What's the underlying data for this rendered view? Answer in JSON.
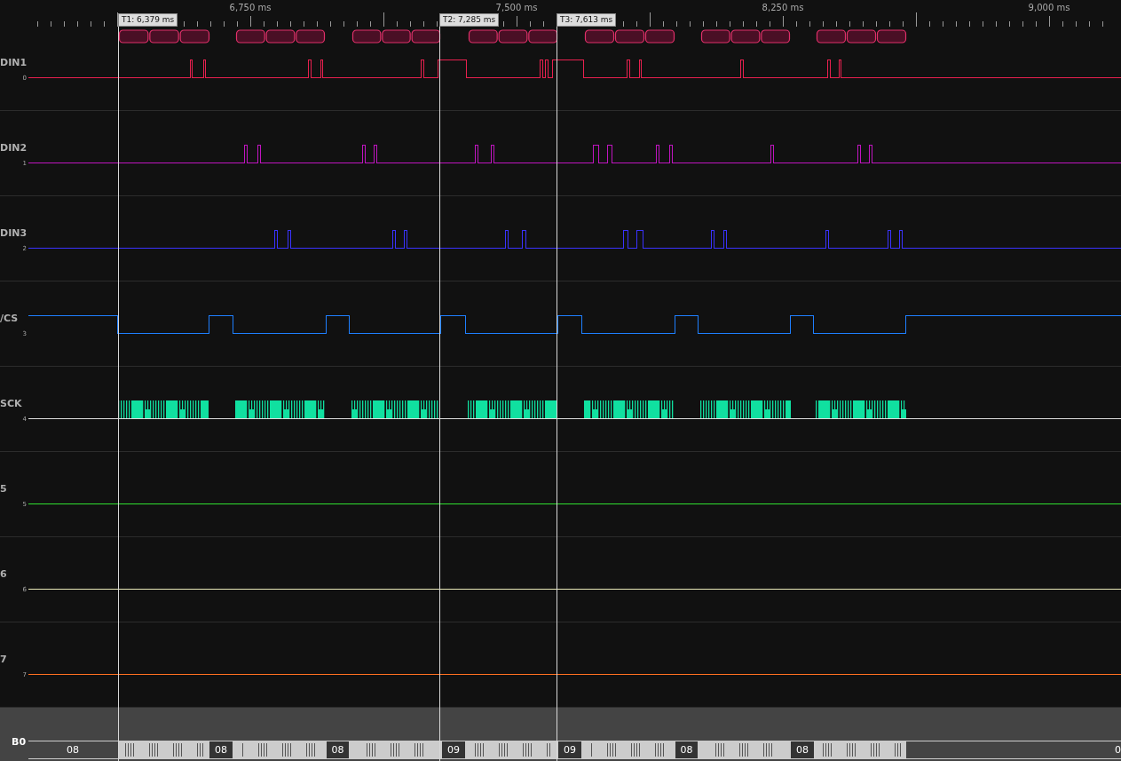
{
  "ruler": {
    "labels": [
      "6,750 ms",
      "7,500 ms",
      "8,250 ms",
      "9,000 ms"
    ]
  },
  "cursors": [
    {
      "label": "T1: 6,379 ms"
    },
    {
      "label": "T2: 7,285 ms"
    },
    {
      "label": "T3: 7,613 ms"
    }
  ],
  "channels": [
    {
      "name": "DIN1",
      "index": "0",
      "color": "#e8204f",
      "kind": "pulses"
    },
    {
      "name": "DIN2",
      "index": "1",
      "color": "#c014c0",
      "kind": "pulses"
    },
    {
      "name": "DIN3",
      "index": "2",
      "color": "#3a32ff",
      "kind": "pulses"
    },
    {
      "name": "/CS",
      "index": "3",
      "color": "#1e7fff",
      "kind": "select"
    },
    {
      "name": "SCK",
      "index": "4",
      "color": "#10e0a0",
      "kind": "clock"
    },
    {
      "name": "5",
      "index": "5",
      "color": "#30e030",
      "kind": "flat"
    },
    {
      "name": "6",
      "index": "6",
      "color": "#e8e8b8",
      "kind": "flat"
    },
    {
      "name": "7",
      "index": "7",
      "color": "#ff7020",
      "kind": "flat"
    }
  ],
  "bus": {
    "name": "B0",
    "values": [
      "08",
      "08",
      "08",
      "09",
      "09",
      "08",
      "08",
      "0"
    ]
  }
}
